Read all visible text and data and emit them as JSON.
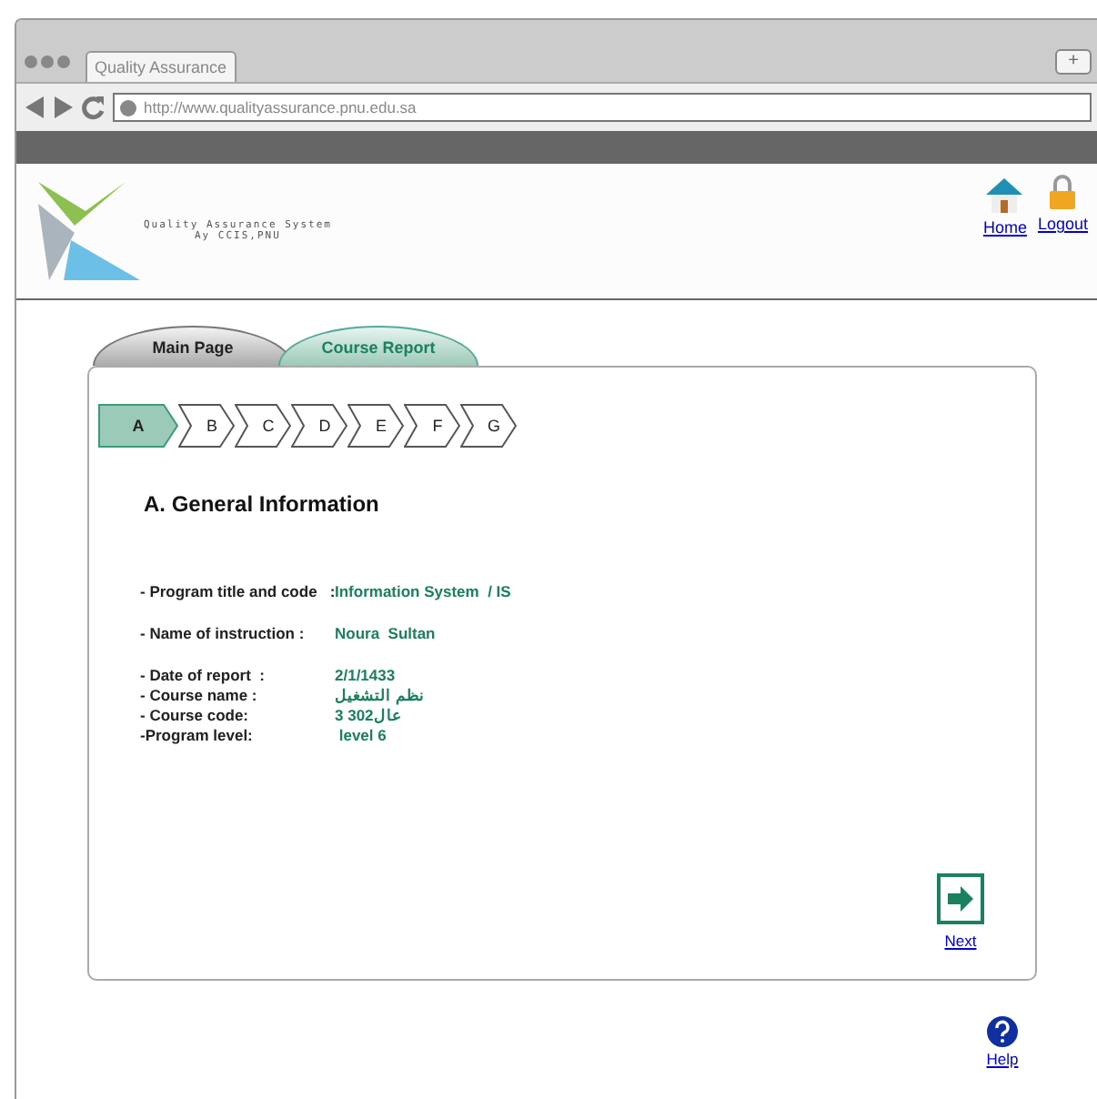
{
  "browser": {
    "tab_title": "Quality Assurance",
    "new_tab": "+",
    "url": "http://www.qualityassurance.pnu.edu.sa"
  },
  "header": {
    "logo_line_1": "Quality Assurance System",
    "logo_line_2": "Ay CCIS,PNU",
    "links": [
      {
        "kind": "home",
        "label": "Home"
      },
      {
        "kind": "logout",
        "label": "Logout"
      }
    ]
  },
  "tabs": [
    {
      "label": "Main Page",
      "selected": false
    },
    {
      "label": "Course Report",
      "selected": true
    }
  ],
  "steps": [
    {
      "label": "A",
      "selected": true
    },
    {
      "label": "B",
      "selected": false
    },
    {
      "label": "C",
      "selected": false
    },
    {
      "label": "D",
      "selected": false
    },
    {
      "label": "E",
      "selected": false
    },
    {
      "label": "F",
      "selected": false
    },
    {
      "label": "G",
      "selected": false
    }
  ],
  "section_title": "A. General Information",
  "field_groups": [
    [
      {
        "label": "- Program title and code   :",
        "value": "Information System  / IS"
      }
    ],
    [
      {
        "label": "- Name of instruction :",
        "value": "Noura  Sultan"
      }
    ],
    [
      {
        "label": "- Date of report  :",
        "value": "2/1/1433"
      },
      {
        "label": "- Course name :",
        "value": "نظم التشغيل"
      },
      {
        "label": "- Course code:",
        "value": "3 عال302"
      },
      {
        "label": "-Program level:",
        "value": " level 6"
      }
    ]
  ],
  "next": {
    "label": "Next"
  },
  "help": {
    "label": "Help"
  }
}
